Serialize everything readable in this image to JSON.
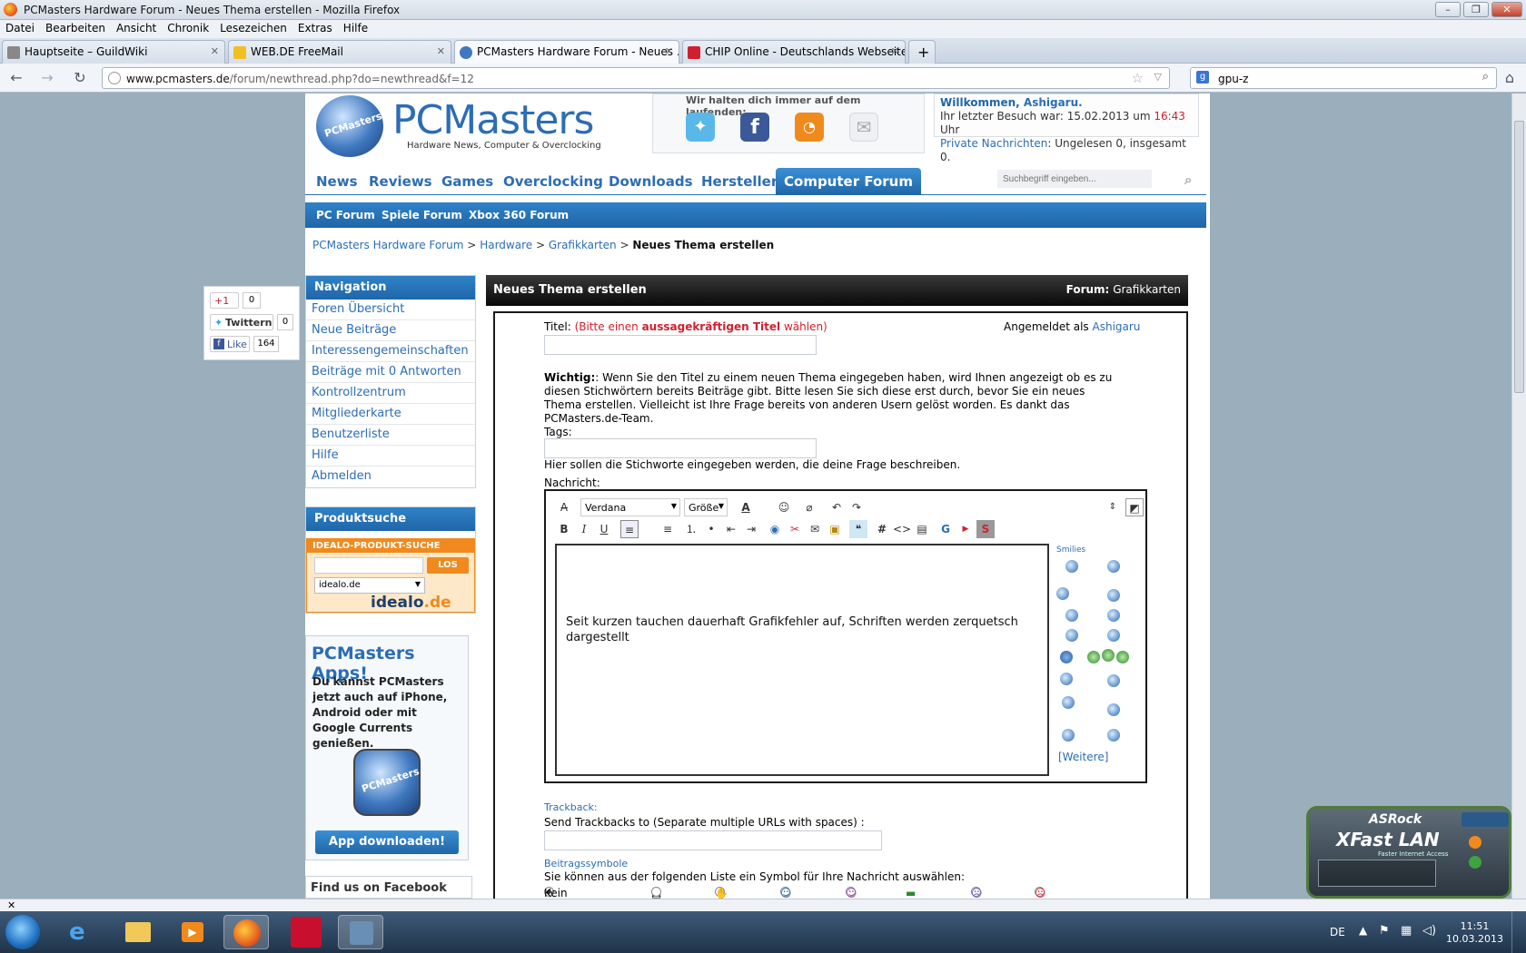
{
  "window": {
    "title": "PCMasters Hardware Forum - Neues Thema erstellen - Mozilla Firefox"
  },
  "menu": [
    "Datei",
    "Bearbeiten",
    "Ansicht",
    "Chronik",
    "Lesezeichen",
    "Extras",
    "Hilfe"
  ],
  "tabs": [
    {
      "label": "Hauptseite – GuildWiki",
      "active": false
    },
    {
      "label": "WEB.DE FreeMail",
      "active": false
    },
    {
      "label": "PCMasters Hardware Forum - Neues ...",
      "active": true
    },
    {
      "label": "CHIP Online - Deutschlands Webseite...",
      "active": false
    }
  ],
  "address": {
    "host": "www.pcmasters.de",
    "path": "/forum/newthread.php?do=newthread&f=12"
  },
  "search": {
    "value": "gpu-z"
  },
  "site": {
    "logo": "PCMasters",
    "logo_ball": "PCMasters",
    "tagline": "Hardware News, Computer & Overclocking",
    "follow_text": "Wir halten dich immer auf dem laufenden:",
    "welcome_pre": "Willkommen, ",
    "welcome_user": "Ashigaru.",
    "last_visit_pre": "Ihr letzter Besuch war: 15.02.2013 um ",
    "last_visit_time": "16:43",
    "last_visit_post": " Uhr",
    "pm_label": "Private Nachrichten",
    "pm_value": ": Ungelesen 0, insgesamt 0."
  },
  "main_nav": [
    "News",
    "Reviews",
    "Games",
    "Overclocking",
    "Downloads",
    "Hersteller",
    "Computer Forum"
  ],
  "site_search_placeholder": "Suchbegriff eingeben...",
  "sub_nav": [
    "PC Forum",
    "Spiele Forum",
    "Xbox 360 Forum"
  ],
  "breadcrumb": {
    "items": [
      "PCMasters Hardware Forum",
      "Hardware",
      "Grafikkarten"
    ],
    "sep": ">",
    "current": "Neues Thema erstellen"
  },
  "share": {
    "gplus": "+1",
    "gplus_count": "0",
    "twitter": "Twittern",
    "twitter_count": "0",
    "like": "Like",
    "like_count": "164"
  },
  "sidebar": {
    "nav_title": "Navigation",
    "nav_items": [
      "Foren Übersicht",
      "Neue Beiträge",
      "Interessengemeinschaften",
      "Beiträge mit 0 Antworten",
      "Kontrollzentrum",
      "Mitgliederkarte",
      "Benutzerliste",
      "Hilfe",
      "Abmelden"
    ],
    "product_title": "Produktsuche",
    "idealo_head": "IDEALO-PRODUKT-SUCHE",
    "idealo_button": "LOS",
    "idealo_select": "idealo.de",
    "idealo_logo_a": "idealo",
    "idealo_logo_b": ".de",
    "apps_title": "PCMasters Apps!",
    "apps_text": "Du kannst PCMasters jetzt auch auf iPhone, Android oder mit Google Currents genießen.",
    "apps_button": "App downloaden!",
    "facebook": "Find us on Facebook"
  },
  "form": {
    "header": "Neues Thema erstellen",
    "forum_label": "Forum:",
    "forum_value": "Grafikkarten",
    "title_label": "Titel:",
    "title_hint_a": "(Bitte einen ",
    "title_hint_b": "aussagekräftigen Titel",
    "title_hint_c": " wählen)",
    "logged_in_pre": "Angemeldet als ",
    "logged_in_user": "Ashigaru",
    "important_label": "Wichtig:",
    "important_text": ": Wenn Sie den Titel zu einem neuen Thema eingegeben haben, wird Ihnen angezeigt ob es zu diesen Stichwörtern bereits Beiträge gibt. Bitte lesen Sie sich diese erst durch, bevor Sie ein neues Thema erstellen. Vielleicht ist Ihre Frage bereits von anderen Usern gelöst worden. Es dankt das PCMasters.de-Team.",
    "tags_label": "Tags:",
    "tags_hint": "Hier sollen die Stichworte eingegeben werden, die deine Frage beschreiben.",
    "message_label": "Nachricht:",
    "font_value": "Verdana",
    "size_value": "Größe",
    "message_text": "Seit kurzen tauchen dauerhaft Grafikfehler auf, Schriften werden zerquetsch dargestellt",
    "smilies_label": "Smilies",
    "smilies_more": "[Weitere]",
    "trackback_title": "Trackback:",
    "trackback_label": "Send Trackbacks to (Separate multiple URLs with spaces) :",
    "icons_title": "Beitragssymbole",
    "icons_text": "Sie können aus der folgenden Liste ein Symbol für Ihre Nachricht auswählen:",
    "no_icon": "Kein Symbol"
  },
  "overlay": {
    "brand": "ASRock",
    "product": "XFast LAN",
    "tag": "Faster Internet Access"
  },
  "taskbar": {
    "lang": "DE",
    "time": "11:51",
    "date": "10.03.2013"
  },
  "colors": {
    "link": "#2c6db5",
    "accent_red": "#d0202e",
    "nav_blue": "#1f66a8"
  }
}
